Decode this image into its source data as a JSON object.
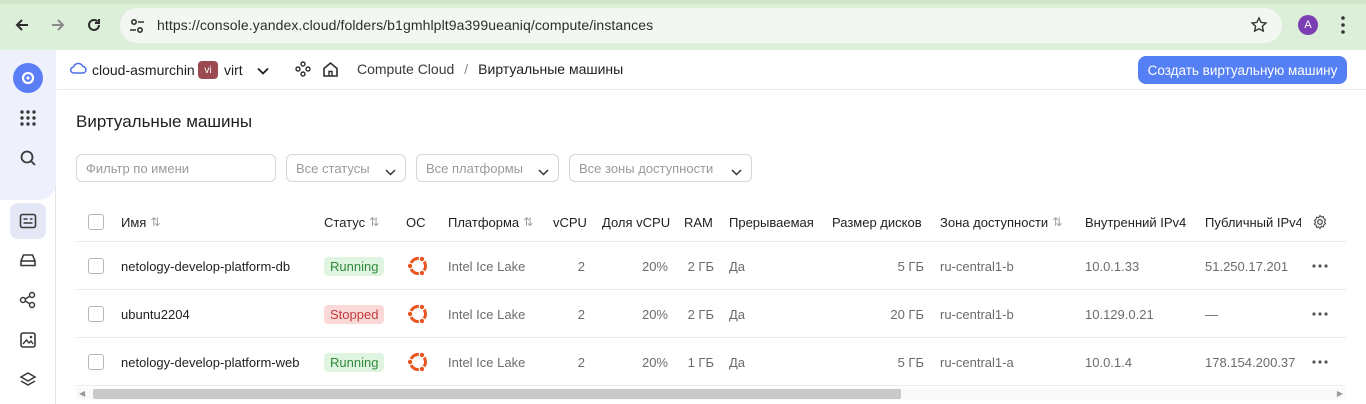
{
  "browser": {
    "url": "https://console.yandex.cloud/folders/b1gmhlplt9a399ueaniq/compute/instances",
    "avatar_letter": "A"
  },
  "header": {
    "cloud_name": "cloud-asmurchin",
    "folder_badge": "vi",
    "folder_name": "virt",
    "breadcrumb_service": "Compute Cloud",
    "breadcrumb_sep": "/",
    "breadcrumb_page": "Виртуальные машины",
    "create_button": "Создать виртуальную машину"
  },
  "page": {
    "title": "Виртуальные машины",
    "filters": {
      "name_placeholder": "Фильтр по имени",
      "status": "Все статусы",
      "platform": "Все платформы",
      "zone": "Все зоны доступности"
    }
  },
  "table": {
    "columns": {
      "name": "Имя",
      "status": "Статус",
      "os": "ОС",
      "platform": "Платформа",
      "vcpu": "vCPU",
      "vcpu_share": "Доля vCPU",
      "ram": "RAM",
      "preemptible": "Прерываемая",
      "disk_size": "Размер дисков",
      "zone": "Зона доступности",
      "internal_ip": "Внутренний IPv4",
      "public_ip": "Публичный IPv4"
    },
    "rows": [
      {
        "name": "netology-develop-platform-db",
        "status": "Running",
        "platform": "Intel Ice Lake",
        "vcpu": "2",
        "vcpu_share": "20%",
        "ram": "2 ГБ",
        "preemptible": "Да",
        "disk_size": "5 ГБ",
        "zone": "ru-central1-b",
        "internal_ip": "10.0.1.33",
        "public_ip": "51.250.17.201"
      },
      {
        "name": "ubuntu2204",
        "status": "Stopped",
        "platform": "Intel Ice Lake",
        "vcpu": "2",
        "vcpu_share": "20%",
        "ram": "2 ГБ",
        "preemptible": "Да",
        "disk_size": "20 ГБ",
        "zone": "ru-central1-b",
        "internal_ip": "10.129.0.21",
        "public_ip": "—"
      },
      {
        "name": "netology-develop-platform-web",
        "status": "Running",
        "platform": "Intel Ice Lake",
        "vcpu": "2",
        "vcpu_share": "20%",
        "ram": "1 ГБ",
        "preemptible": "Да",
        "disk_size": "5 ГБ",
        "zone": "ru-central1-a",
        "internal_ip": "10.0.1.4",
        "public_ip": "178.154.200.37"
      }
    ]
  },
  "colors": {
    "accent": "#5580f5",
    "running_bg": "#dff5e1",
    "stopped_bg": "#fbd9d9",
    "ubuntu_orange": "#e9541f"
  },
  "icons": {
    "os": "ubuntu-icon",
    "row_menu": "more-horizontal-icon"
  }
}
